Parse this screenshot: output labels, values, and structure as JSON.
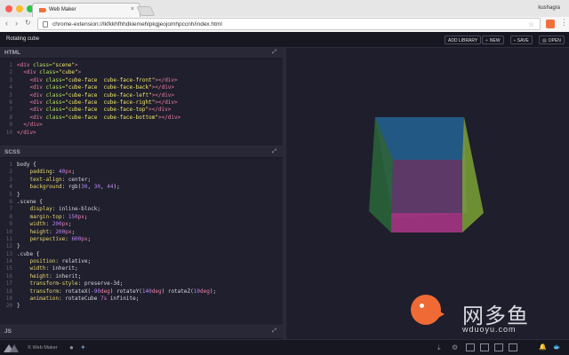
{
  "browser": {
    "tab_title": "Web Maker",
    "tab_close": "×",
    "user": "kushagra",
    "url": "chrome-extension://lkfkkhfhhdkiemehlpkgjeojomhpccnh/index.html",
    "back": "‹",
    "forward": "›",
    "reload": "↻",
    "star": "☆",
    "menu": "⋮",
    "colors": {
      "close": "#fc5f57",
      "minimize": "#fdbc2e",
      "maximize": "#28c840"
    }
  },
  "app": {
    "title": "Rotating cube",
    "buttons": {
      "add_library": "ADD LIBRARY",
      "new": "NEW",
      "save": "SAVE",
      "open": "OPEN"
    },
    "icons": {
      "new": "+",
      "save": "▪",
      "open": "▤"
    }
  },
  "panes": {
    "html": {
      "title": "HTML",
      "lines": [
        [
          [
            "tg",
            "<div "
          ],
          [
            "at",
            "class="
          ],
          [
            "st",
            "\"scene\""
          ],
          [
            "tg",
            ">"
          ]
        ],
        [
          [
            "tx",
            "  "
          ],
          [
            "tg",
            "<div "
          ],
          [
            "at",
            "class="
          ],
          [
            "st",
            "\"cube\""
          ],
          [
            "tg",
            ">"
          ]
        ],
        [
          [
            "tx",
            "    "
          ],
          [
            "tg",
            "<div "
          ],
          [
            "at",
            "class="
          ],
          [
            "st",
            "\"cube-face  cube-face-front\""
          ],
          [
            "tg",
            "></div>"
          ]
        ],
        [
          [
            "tx",
            "    "
          ],
          [
            "tg",
            "<div "
          ],
          [
            "at",
            "class="
          ],
          [
            "st",
            "\"cube-face  cube-face-back\""
          ],
          [
            "tg",
            "></div>"
          ]
        ],
        [
          [
            "tx",
            "    "
          ],
          [
            "tg",
            "<div "
          ],
          [
            "at",
            "class="
          ],
          [
            "st",
            "\"cube-face  cube-face-left\""
          ],
          [
            "tg",
            "></div>"
          ]
        ],
        [
          [
            "tx",
            "    "
          ],
          [
            "tg",
            "<div "
          ],
          [
            "at",
            "class="
          ],
          [
            "st",
            "\"cube-face  cube-face-right\""
          ],
          [
            "tg",
            "></div>"
          ]
        ],
        [
          [
            "tx",
            "    "
          ],
          [
            "tg",
            "<div "
          ],
          [
            "at",
            "class="
          ],
          [
            "st",
            "\"cube-face  cube-face-top\""
          ],
          [
            "tg",
            "></div>"
          ]
        ],
        [
          [
            "tx",
            "    "
          ],
          [
            "tg",
            "<div "
          ],
          [
            "at",
            "class="
          ],
          [
            "st",
            "\"cube-face  cube-face-bottom\""
          ],
          [
            "tg",
            "></div>"
          ]
        ],
        [
          [
            "tx",
            "  "
          ],
          [
            "tg",
            "</div>"
          ]
        ],
        [
          [
            "tg",
            "</div>"
          ]
        ]
      ]
    },
    "scss": {
      "title": "SCSS",
      "lines": [
        [
          [
            "sl",
            "body "
          ],
          [
            "tx",
            "{"
          ]
        ],
        [
          [
            "tx",
            "    "
          ],
          [
            "pr",
            "padding"
          ],
          [
            "tx",
            ": "
          ],
          [
            "nm",
            "40"
          ],
          [
            "un",
            "px"
          ],
          [
            "tx",
            ";"
          ]
        ],
        [
          [
            "tx",
            "    "
          ],
          [
            "pr",
            "text-align"
          ],
          [
            "tx",
            ": "
          ],
          [
            "sl",
            "center"
          ],
          [
            "tx",
            ";"
          ]
        ],
        [
          [
            "tx",
            "    "
          ],
          [
            "pr",
            "background"
          ],
          [
            "tx",
            ": "
          ],
          [
            "sl",
            "rgb("
          ],
          [
            "nm",
            "30"
          ],
          [
            "sl",
            ", "
          ],
          [
            "nm",
            "30"
          ],
          [
            "sl",
            ", "
          ],
          [
            "nm",
            "44"
          ],
          [
            "sl",
            ")"
          ],
          [
            "tx",
            ";"
          ]
        ],
        [
          [
            "tx",
            "}"
          ]
        ],
        [
          [
            "sl",
            ".scene "
          ],
          [
            "tx",
            "{"
          ]
        ],
        [
          [
            "tx",
            "    "
          ],
          [
            "pr",
            "display"
          ],
          [
            "tx",
            ": "
          ],
          [
            "sl",
            "inline-block"
          ],
          [
            "tx",
            ";"
          ]
        ],
        [
          [
            "tx",
            "    "
          ],
          [
            "pr",
            "margin-top"
          ],
          [
            "tx",
            ": "
          ],
          [
            "nm",
            "150"
          ],
          [
            "un",
            "px"
          ],
          [
            "tx",
            ";"
          ]
        ],
        [
          [
            "tx",
            "    "
          ],
          [
            "pr",
            "width"
          ],
          [
            "tx",
            ": "
          ],
          [
            "nm",
            "200"
          ],
          [
            "un",
            "px"
          ],
          [
            "tx",
            ";"
          ]
        ],
        [
          [
            "tx",
            "    "
          ],
          [
            "pr",
            "height"
          ],
          [
            "tx",
            ": "
          ],
          [
            "nm",
            "200"
          ],
          [
            "un",
            "px"
          ],
          [
            "tx",
            ";"
          ]
        ],
        [
          [
            "tx",
            "    "
          ],
          [
            "pr",
            "perspective"
          ],
          [
            "tx",
            ": "
          ],
          [
            "nm",
            "600"
          ],
          [
            "un",
            "px"
          ],
          [
            "tx",
            ";"
          ]
        ],
        [
          [
            "tx",
            "}"
          ]
        ],
        [
          [
            "sl",
            ".cube "
          ],
          [
            "tx",
            "{"
          ]
        ],
        [
          [
            "tx",
            "    "
          ],
          [
            "pr",
            "position"
          ],
          [
            "tx",
            ": "
          ],
          [
            "sl",
            "relative"
          ],
          [
            "tx",
            ";"
          ]
        ],
        [
          [
            "tx",
            "    "
          ],
          [
            "pr",
            "width"
          ],
          [
            "tx",
            ": "
          ],
          [
            "sl",
            "inherit"
          ],
          [
            "tx",
            ";"
          ]
        ],
        [
          [
            "tx",
            "    "
          ],
          [
            "pr",
            "height"
          ],
          [
            "tx",
            ": "
          ],
          [
            "sl",
            "inherit"
          ],
          [
            "tx",
            ";"
          ]
        ],
        [
          [
            "tx",
            "    "
          ],
          [
            "pr",
            "transform-style"
          ],
          [
            "tx",
            ": "
          ],
          [
            "sl",
            "preserve-3d"
          ],
          [
            "tx",
            ";"
          ]
        ],
        [
          [
            "tx",
            "    "
          ],
          [
            "pr",
            "transform"
          ],
          [
            "tx",
            ": "
          ],
          [
            "sl",
            "rotateX("
          ],
          [
            "nm",
            "-90"
          ],
          [
            "un",
            "deg"
          ],
          [
            "sl",
            ") rotateY("
          ],
          [
            "nm",
            "140"
          ],
          [
            "un",
            "deg"
          ],
          [
            "sl",
            ") rotateZ("
          ],
          [
            "nm",
            "10"
          ],
          [
            "un",
            "deg"
          ],
          [
            "sl",
            ")"
          ],
          [
            "tx",
            ";"
          ]
        ],
        [
          [
            "tx",
            "    "
          ],
          [
            "pr",
            "animation"
          ],
          [
            "tx",
            ": "
          ],
          [
            "sl",
            "rotateCube "
          ],
          [
            "nm",
            "7"
          ],
          [
            "un",
            "s"
          ],
          [
            "sl",
            " infinite"
          ],
          [
            "tx",
            ";"
          ]
        ],
        [
          [
            "tx",
            "}"
          ]
        ]
      ]
    },
    "js": {
      "title": "JS"
    },
    "expand_icon": "⤢"
  },
  "footer": {
    "label": "© Web Maker",
    "icons": {
      "twitter": "✦",
      "download": "⤓",
      "settings": "⚙",
      "bell": "🔔",
      "fish": "🐟"
    }
  },
  "watermark": {
    "text": "网多鱼",
    "url": "wduoyu.com"
  },
  "cube_faces": {
    "top": "#1f5f8b",
    "left": "#2b6b3a",
    "right": "#8ab437",
    "front": "#6b3a6a",
    "bottom": "#b5338a",
    "back": "#3e3b64"
  }
}
